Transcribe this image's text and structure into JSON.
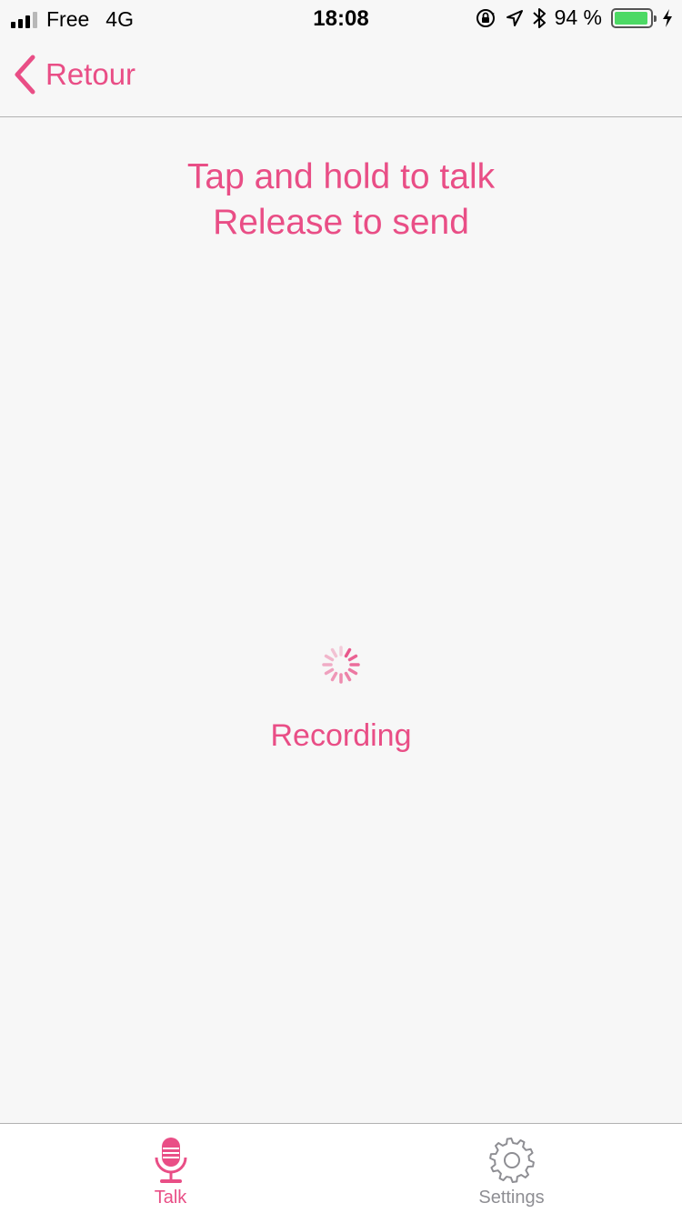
{
  "status_bar": {
    "carrier": "Free",
    "network": "4G",
    "time": "18:08",
    "battery_percent": "94 %",
    "battery_level": 0.94,
    "icons": [
      "signal-icon",
      "orientation-lock-icon",
      "location-icon",
      "bluetooth-icon",
      "battery-icon",
      "charging-icon"
    ]
  },
  "nav": {
    "back_label": "Retour",
    "back_icon": "chevron-left-icon"
  },
  "main": {
    "instruction_line1": "Tap and hold to talk",
    "instruction_line2": "Release to send",
    "status_label": "Recording",
    "spinner_icon": "activity-spinner-icon"
  },
  "tab_bar": {
    "tabs": [
      {
        "label": "Talk",
        "icon": "microphone-icon",
        "selected": true
      },
      {
        "label": "Settings",
        "icon": "gear-icon",
        "selected": false
      }
    ]
  },
  "colors": {
    "accent": "#e94e86",
    "background": "#f7f7f7",
    "inactive": "#8e8e93",
    "battery_fill": "#4cd964"
  }
}
